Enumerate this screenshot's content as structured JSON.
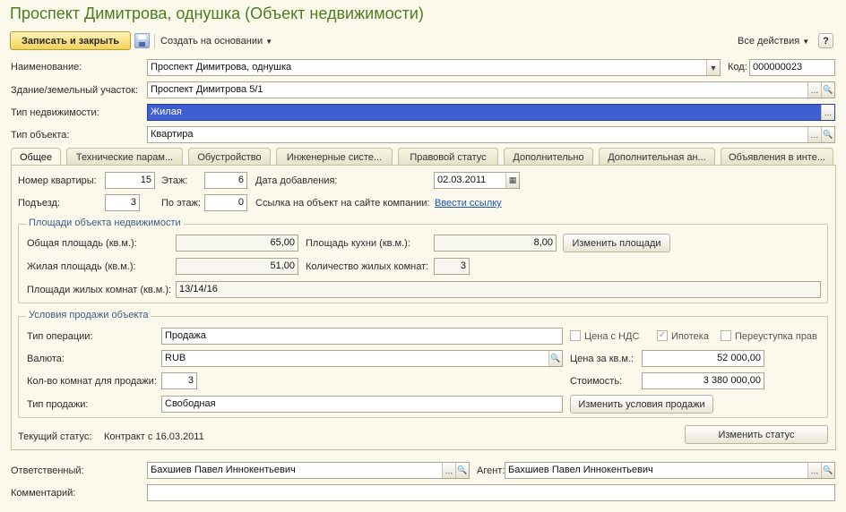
{
  "title": "Проспект Димитрова, однушка (Объект недвижимости)",
  "toolbar": {
    "save_close": "Записать и закрыть",
    "create_based": "Создать на основании",
    "all_actions": "Все действия",
    "help": "?"
  },
  "fields": {
    "name_label": "Наименование:",
    "name_value": "Проспект Димитрова, однушка",
    "code_label": "Код:",
    "code_value": "000000023",
    "building_label": "Здание/земельный участок:",
    "building_value": "Проспект Димитрова 5/1",
    "estate_type_label": "Тип недвижимости:",
    "estate_type_value": "Жилая",
    "object_type_label": "Тип объекта:",
    "object_type_value": "Квартира"
  },
  "tabs": [
    {
      "label": "Общее"
    },
    {
      "label": "Технические парам..."
    },
    {
      "label": "Обустройство"
    },
    {
      "label": "Инженерные систе..."
    },
    {
      "label": "Правовой статус"
    },
    {
      "label": "Дополнительно"
    },
    {
      "label": "Дополнительная ан..."
    },
    {
      "label": "Объявления в инте..."
    }
  ],
  "general": {
    "apt_no_label": "Номер квартиры:",
    "apt_no_value": "15",
    "floor_label": "Этаж:",
    "floor_value": "6",
    "date_added_label": "Дата добавления:",
    "date_added_value": "02.03.2011",
    "entrance_label": "Подъезд:",
    "entrance_value": "3",
    "floors_label": "По этаж:",
    "floors_value": "0",
    "site_link_label": "Ссылка на объект на сайте компании:",
    "site_link_value": "Ввести ссылку"
  },
  "areas": {
    "group_title": "Площади объекта недвижимости",
    "total_label": "Общая площадь (кв.м.):",
    "total_value": "65,00",
    "kitchen_label": "Площадь кухни (кв.м.):",
    "kitchen_value": "8,00",
    "change_areas": "Изменить площади",
    "living_label": "Жилая площадь (кв.м.):",
    "living_value": "51,00",
    "rooms_label": "Количество жилых комнат:",
    "rooms_value": "3",
    "room_areas_label": "Площади жилых комнат (кв.м.):",
    "room_areas_value": "13/14/16"
  },
  "sale": {
    "group_title": "Условия продажи объекта",
    "op_type_label": "Тип операции:",
    "op_type_value": "Продажа",
    "vat_label": "Цена с НДС",
    "mortgage_label": "Ипотека",
    "assign_label": "Переуступка прав",
    "currency_label": "Валюта:",
    "currency_value": "RUB",
    "price_sqm_label": "Цена за кв.м.:",
    "price_sqm_value": "52 000,00",
    "rooms_sale_label": "Кол-во комнат для продажи:",
    "rooms_sale_value": "3",
    "cost_label": "Стоимость:",
    "cost_value": "3 380 000,00",
    "sale_type_label": "Тип продажи:",
    "sale_type_value": "Свободная",
    "change_terms": "Изменить условия продажи"
  },
  "status": {
    "label": "Текущий статус:",
    "value": "Контракт с 16.03.2011",
    "change_status": "Изменить статус"
  },
  "footer": {
    "responsible_label": "Ответственный:",
    "responsible_value": "Бахшиев Павел Иннокентьевич",
    "agent_label": "Агент:",
    "agent_value": "Бахшиев Павел Иннокентьевич",
    "comment_label": "Комментарий:",
    "comment_value": ""
  },
  "colors": {
    "title": "#4b7d1d",
    "background": "#fbf9ec",
    "selection": "#3f5fd0",
    "link": "#1a56b0",
    "group_title": "#3a5a82"
  }
}
